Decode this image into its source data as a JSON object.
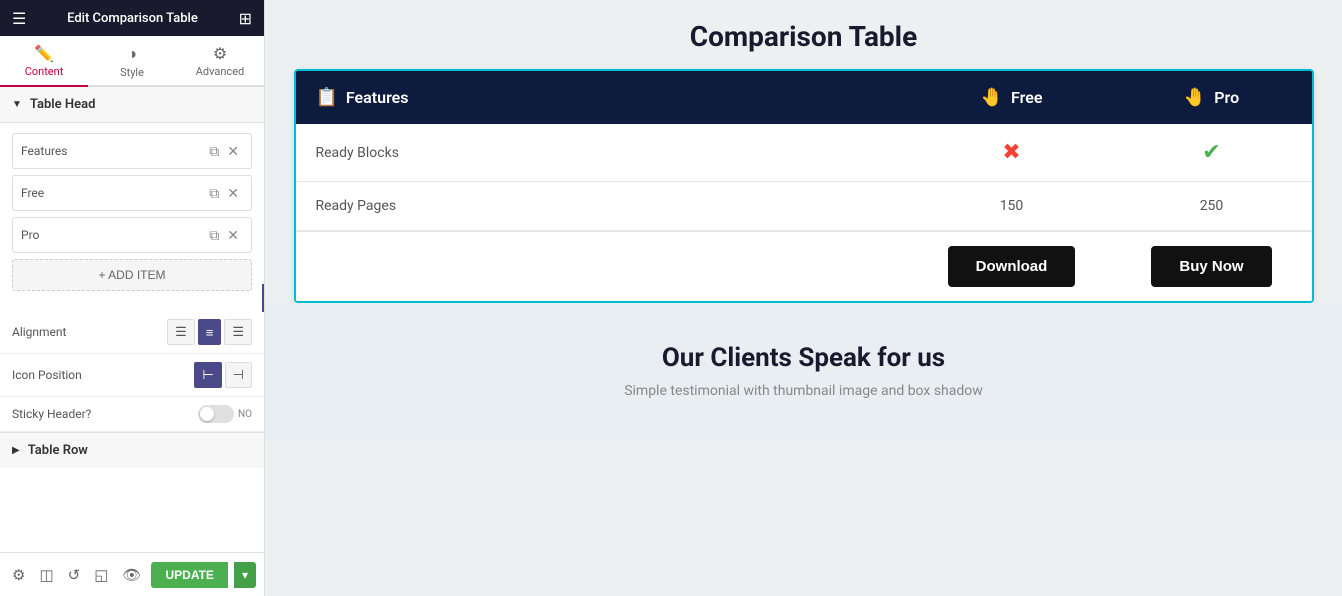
{
  "panel": {
    "header_title": "Edit Comparison Table",
    "hamburger": "☰",
    "grid": "⊞",
    "tabs": [
      {
        "id": "content",
        "label": "Content",
        "icon": "✏️",
        "active": true
      },
      {
        "id": "style",
        "label": "Style",
        "icon": "◑"
      },
      {
        "id": "advanced",
        "label": "Advanced",
        "icon": "⚙"
      }
    ],
    "table_head_label": "Table Head",
    "items": [
      {
        "id": 1,
        "label": "Features"
      },
      {
        "id": 2,
        "label": "Free"
      },
      {
        "id": 3,
        "label": "Pro"
      }
    ],
    "add_item_label": "+ ADD ITEM",
    "alignment_label": "Alignment",
    "align_options": [
      "left",
      "center",
      "right"
    ],
    "icon_position_label": "Icon Position",
    "icon_pos_options": [
      "left",
      "right"
    ],
    "sticky_header_label": "Sticky Header?",
    "sticky_toggle_state": "NO",
    "table_row_label": "Table Row",
    "footer_icons": [
      "⚙",
      "◫",
      "↺",
      "◱",
      "👁"
    ],
    "update_label": "UPDATE",
    "update_arrow": "▾"
  },
  "main": {
    "page_title": "Comparison Table",
    "table": {
      "head_col1": "Features",
      "head_col2": "Free",
      "head_col3": "Pro",
      "head_icon1": "📋",
      "head_icon2": "🤚",
      "head_icon3": "🤚",
      "rows": [
        {
          "feature": "Ready Blocks",
          "col2_type": "cross",
          "col3_type": "check"
        },
        {
          "feature": "Ready Pages",
          "col2_val": "150",
          "col3_val": "250"
        }
      ],
      "cta_col2_label": "Download",
      "cta_col3_label": "Buy Now"
    },
    "clients_title": "Our Clients Speak for us",
    "clients_subtitle": "Simple testimonial with thumbnail image and box shadow"
  },
  "colors": {
    "table_head_bg": "#0d1b3e",
    "accent": "#c0003c",
    "update_green": "#4caf50",
    "check_green": "#4caf50",
    "cross_red": "#f44336"
  }
}
